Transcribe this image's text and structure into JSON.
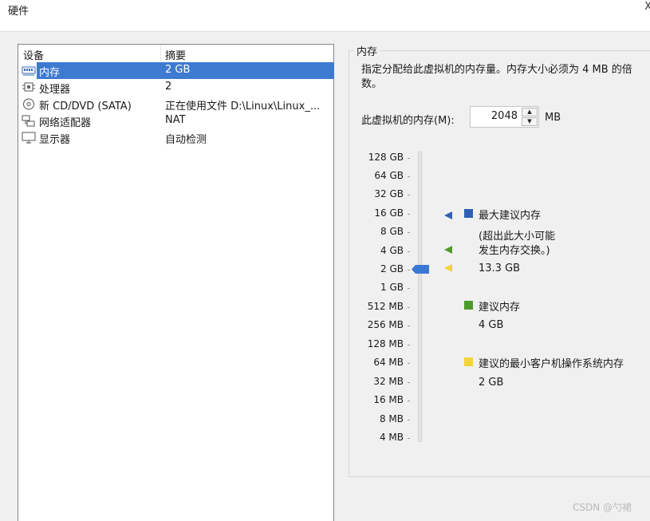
{
  "window": {
    "title": "硬件",
    "close_glyph": "X"
  },
  "device_list": {
    "columns": [
      "设备",
      "摘要"
    ],
    "rows": [
      {
        "name": "内存",
        "summary": "2 GB",
        "icon": "memory-icon",
        "selected": true
      },
      {
        "name": "处理器",
        "summary": "2",
        "icon": "cpu-icon",
        "selected": false
      },
      {
        "name": "新 CD/DVD (SATA)",
        "summary": "正在使用文件 D:\\Linux\\Linux_...",
        "icon": "cd-dvd-icon",
        "selected": false
      },
      {
        "name": "网络适配器",
        "summary": "NAT",
        "icon": "network-adapter-icon",
        "selected": false
      },
      {
        "name": "显示器",
        "summary": "自动检测",
        "icon": "display-icon",
        "selected": false
      }
    ]
  },
  "memory": {
    "group_title": "内存",
    "description": "指定分配给此虚拟机的内存量。内存大小必须为 4 MB 的倍数。",
    "label": "此虚拟机的内存(M):",
    "value": "2048",
    "unit": "MB",
    "scale": [
      "128 GB",
      "64 GB",
      "32 GB",
      "16 GB",
      "8 GB",
      "4 GB",
      "2 GB",
      "1 GB",
      "512 MB",
      "256 MB",
      "128 MB",
      "64 MB",
      "32 MB",
      "16 MB",
      "8 MB",
      "4 MB"
    ],
    "selected_level": "2 GB",
    "legend": {
      "max": {
        "title": "最大建议内存",
        "note_line1": "(超出此大小可能",
        "note_line2": "发生内存交换。)",
        "value": "13.3 GB",
        "color": "#2e5fb4"
      },
      "recommended": {
        "title": "建议内存",
        "value": "4 GB",
        "color": "#4d9a2a"
      },
      "min": {
        "title": "建议的最小客户机操作系统内存",
        "value": "2 GB",
        "color": "#f2d33a"
      }
    }
  },
  "watermark": "CSDN @勺裙"
}
